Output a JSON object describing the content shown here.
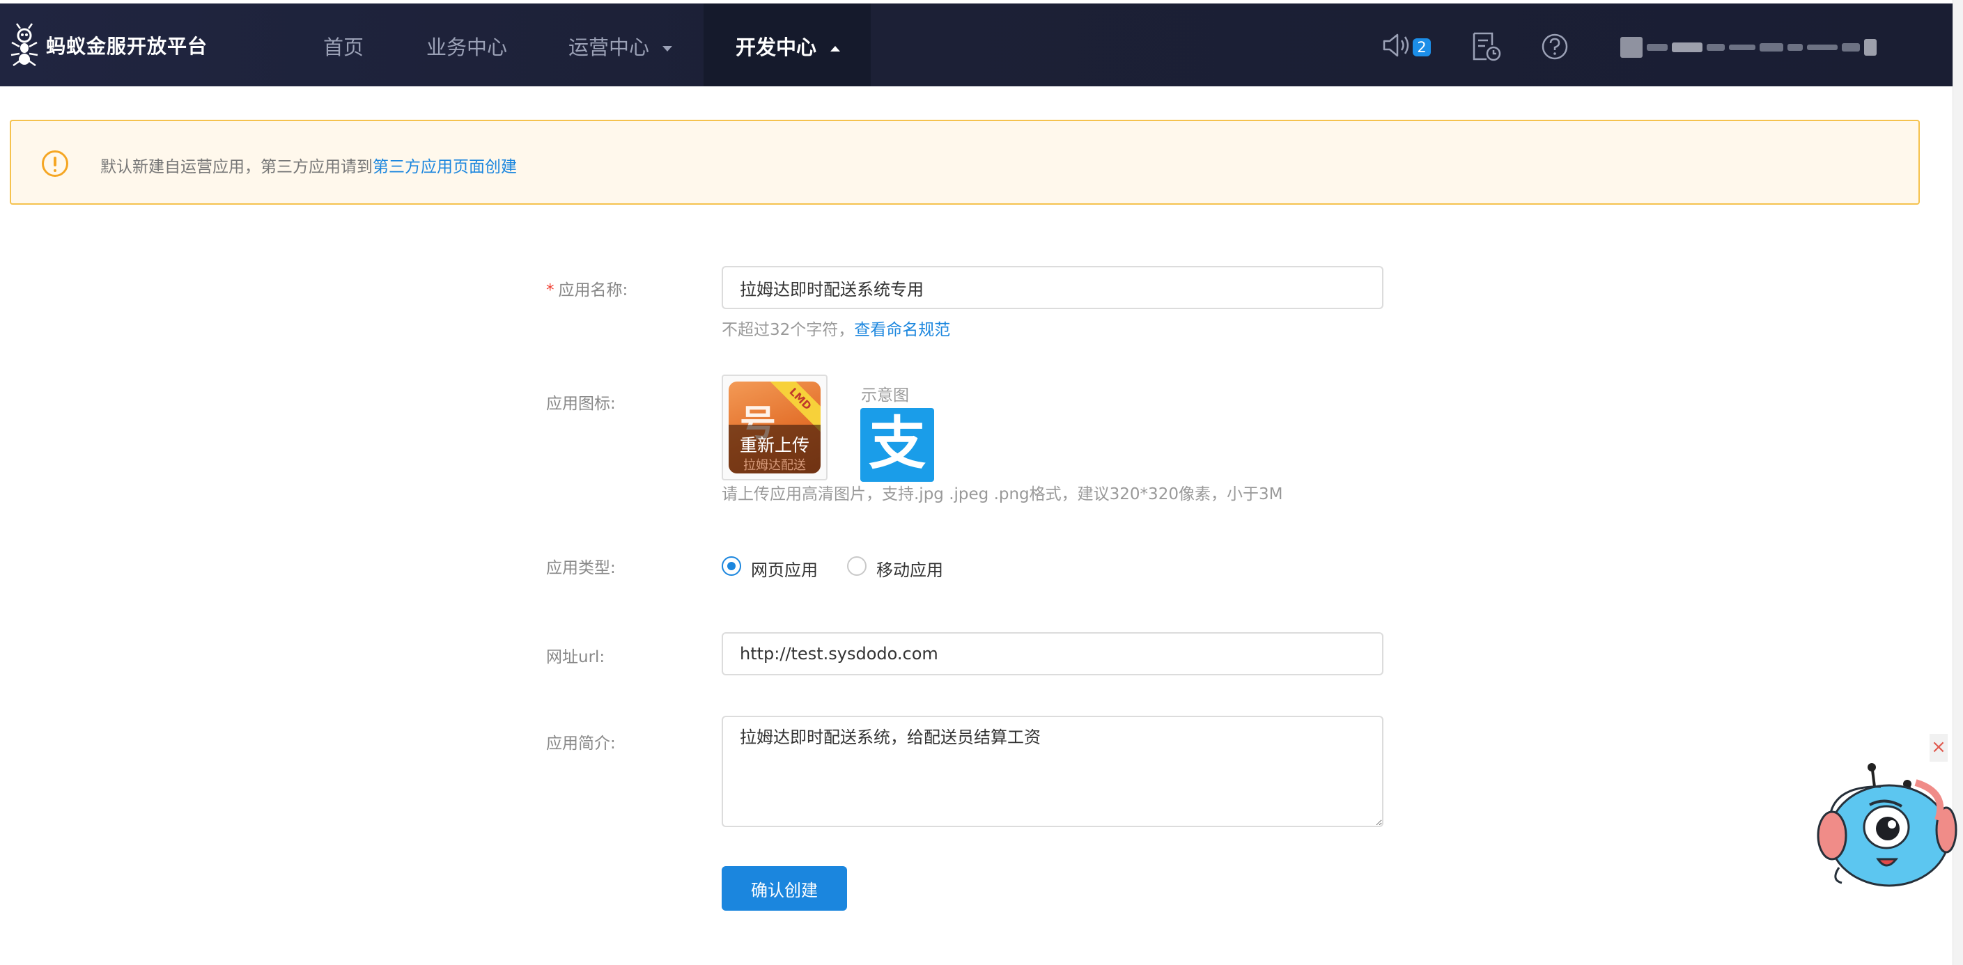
{
  "header": {
    "brand": "蚂蚁金服开放平台",
    "nav": [
      {
        "label": "首页"
      },
      {
        "label": "业务中心"
      },
      {
        "label": "运营中心"
      },
      {
        "label": "开发中心"
      }
    ],
    "notification_count": "2",
    "icons": [
      "ant-logo-icon",
      "speaker-icon",
      "document-clock-icon",
      "help-icon"
    ]
  },
  "notice": {
    "text": "默认新建自运营应用，第三方应用请到",
    "link": "第三方应用页面创建"
  },
  "form": {
    "name": {
      "label": "应用名称:",
      "value": "拉姆达即时配送系统专用",
      "hint": "不超过32个字符，",
      "hint_link": "查看命名规范"
    },
    "icon": {
      "label": "应用图标:",
      "reupload": "重新上传",
      "icon_subtext": "拉姆达配送",
      "ribbon": "LMD",
      "demo_label": "示意图",
      "demo_glyph": "支",
      "hint": "请上传应用高清图片，支持.jpg .jpeg .png格式，建议320*320像素，小于3M"
    },
    "type": {
      "label": "应用类型:",
      "options": [
        "网页应用",
        "移动应用"
      ],
      "selected": "网页应用"
    },
    "url": {
      "label": "网址url:",
      "value": "http://test.sysdodo.com"
    },
    "intro": {
      "label": "应用简介:",
      "value": "拉姆达即时配送系统，给配送员结算工资"
    },
    "submit": "确认创建"
  },
  "mascot": {
    "close": "×"
  },
  "colors": {
    "accent": "#1b86de",
    "topbar": "#1c2036",
    "notice_border": "#f5c24e",
    "required": "#f04134"
  }
}
